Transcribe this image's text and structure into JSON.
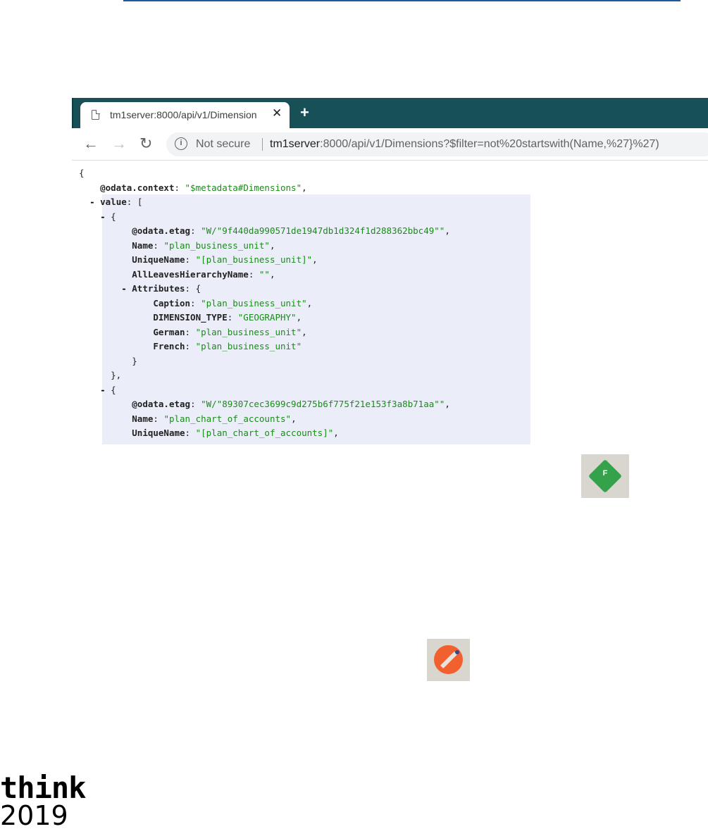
{
  "browser": {
    "tab_title": "tm1server:8000/api/v1/Dimension",
    "tab_close": "✕",
    "new_tab": "+",
    "nav": {
      "back": "←",
      "forward": "→",
      "reload": "↻"
    },
    "security_label": "Not secure",
    "url_host": "tm1server",
    "url_path": ":8000/api/v1/Dimensions?$filter=not%20startswith(Name,%27}%27)"
  },
  "json_view": {
    "lines": [
      {
        "indent": "",
        "toggle": "",
        "key": "",
        "value": "",
        "tail": "{"
      },
      {
        "indent": "    ",
        "toggle": "",
        "key": "@odata.context",
        "value": "\"$metadata#Dimensions\"",
        "tail": ","
      },
      {
        "indent": "  ",
        "toggle": "- ",
        "key": "value",
        "value": "",
        "tail": "["
      },
      {
        "indent": "    ",
        "toggle": "- ",
        "key": "",
        "value": "",
        "tail": "{"
      },
      {
        "indent": "          ",
        "toggle": "",
        "key": "@odata.etag",
        "value": "\"W/\"9f440da990571de1947db1d324f1d288362bbc49\"\"",
        "tail": ","
      },
      {
        "indent": "          ",
        "toggle": "",
        "key": "Name",
        "value": "\"plan_business_unit\"",
        "tail": ","
      },
      {
        "indent": "          ",
        "toggle": "",
        "key": "UniqueName",
        "value": "\"[plan_business_unit]\"",
        "tail": ","
      },
      {
        "indent": "          ",
        "toggle": "",
        "key": "AllLeavesHierarchyName",
        "value": "\"\"",
        "tail": ","
      },
      {
        "indent": "        ",
        "toggle": "- ",
        "key": "Attributes",
        "value": "",
        "tail": "{"
      },
      {
        "indent": "              ",
        "toggle": "",
        "key": "Caption",
        "value": "\"plan_business_unit\"",
        "tail": ","
      },
      {
        "indent": "              ",
        "toggle": "",
        "key": "DIMENSION_TYPE",
        "value": "\"GEOGRAPHY\"",
        "tail": ","
      },
      {
        "indent": "              ",
        "toggle": "",
        "key": "German",
        "value": "\"plan_business_unit\"",
        "tail": ","
      },
      {
        "indent": "              ",
        "toggle": "",
        "key": "French",
        "value": "\"plan_business_unit\"",
        "tail": ""
      },
      {
        "indent": "          ",
        "toggle": "",
        "key": "",
        "value": "",
        "tail": "}"
      },
      {
        "indent": "      ",
        "toggle": "",
        "key": "",
        "value": "",
        "tail": "},"
      },
      {
        "indent": "    ",
        "toggle": "- ",
        "key": "",
        "value": "",
        "tail": "{"
      },
      {
        "indent": "          ",
        "toggle": "",
        "key": "@odata.etag",
        "value": "\"W/\"89307cec3699c9d275b6f775f21e153f3a8b71aa\"\"",
        "tail": ","
      },
      {
        "indent": "          ",
        "toggle": "",
        "key": "Name",
        "value": "\"plan_chart_of_accounts\"",
        "tail": ","
      },
      {
        "indent": "          ",
        "toggle": "",
        "key": "UniqueName",
        "value": "\"[plan_chart_of_accounts]\"",
        "tail": ","
      }
    ]
  },
  "icons": {
    "diamond_letter": "F",
    "diamond_color": "#33a24a",
    "pencil_color": "#f0612f"
  },
  "logo": {
    "word": "think",
    "year": "2019"
  },
  "colors": {
    "tabbar": "#185057",
    "json_string": "#1a8b1a",
    "highlight": "#ebeef8"
  }
}
